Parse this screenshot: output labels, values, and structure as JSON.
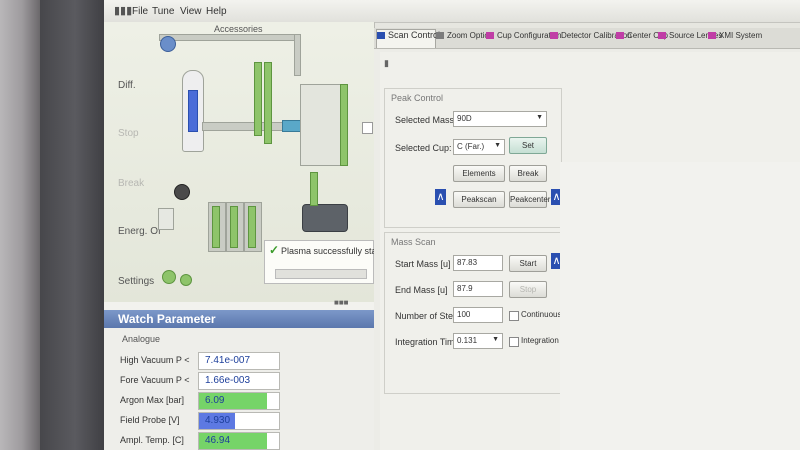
{
  "menu": {
    "items": [
      "File",
      "Tune",
      "View",
      "Help"
    ]
  },
  "accessories": {
    "title": "Accessories",
    "side_labels": [
      "Diff.",
      "Stop",
      "Break",
      "Energ. Of",
      "Settings"
    ],
    "tooltip": "Plasma successfully started"
  },
  "watch": {
    "title": "Watch Parameter",
    "section": "Analogue",
    "rows": [
      {
        "label": "High Vacuum P <",
        "value": "7.41e-007",
        "color": "#ffffff",
        "fill": 0
      },
      {
        "label": "Fore Vacuum P <",
        "value": "1.66e-003",
        "color": "#ffffff",
        "fill": 0
      },
      {
        "label": "Argon Max [bar]",
        "value": "6.09",
        "color": "#76d468",
        "fill": 0.85
      },
      {
        "label": "Field Probe [V]",
        "value": "4.930",
        "color": "#5d79e2",
        "fill": 0.45
      },
      {
        "label": "Ampl. Temp. [C]",
        "value": "46.94",
        "color": "#76d468",
        "fill": 0.85
      }
    ]
  },
  "tabs": [
    {
      "label": "Scan Control",
      "icon_color": "#2a4fb0"
    },
    {
      "label": "Zoom Optics",
      "icon_color": "#7c7c7c"
    },
    {
      "label": "Cup Configuration",
      "icon_color": "#c03ea6"
    },
    {
      "label": "Detector Calibration",
      "icon_color": "#c03ea6"
    },
    {
      "label": "Center Cup",
      "icon_color": "#c03ea6"
    },
    {
      "label": "Source Lenses",
      "icon_color": "#c03ea6"
    },
    {
      "label": "XMI System",
      "icon_color": "#c03ea6"
    }
  ],
  "scan": {
    "peak_control": {
      "title": "Peak Control",
      "selected_mass_label": "Selected Mass:",
      "selected_mass": "90D",
      "selected_cup_label": "Selected Cup:",
      "selected_cup": "C (Far.)",
      "set_label": "Set",
      "elements_label": "Elements",
      "break_label": "Break",
      "peakscan_label": "Peakscan",
      "peakcenter_label": "Peakcenter"
    },
    "mass_scan": {
      "title": "Mass Scan",
      "start_label": "Start Mass [u]",
      "start_value": "87.83",
      "end_label": "End Mass [u]",
      "end_value": "87.9",
      "steps_label": "Number of Steps:",
      "steps_value": "100",
      "time_label": "Integration Time [s]",
      "time_value": "0.131",
      "start_btn": "Start",
      "stop_btn": "Stop",
      "continuous_label": "Continuous Mode",
      "integration_label": "Integration Mode"
    }
  }
}
